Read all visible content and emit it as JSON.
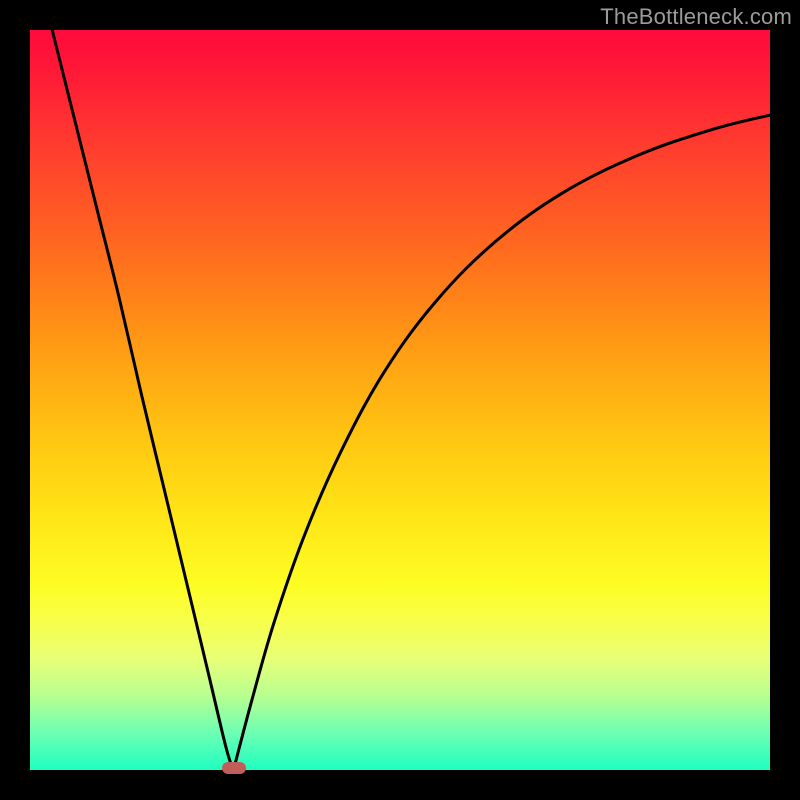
{
  "watermark": "TheBottleneck.com",
  "colors": {
    "frame_bg": "#000000",
    "watermark": "#9b9b9b",
    "curve": "#000000",
    "pill": "#c15e59",
    "gradient_stops": [
      "#ff0a3c",
      "#ff1737",
      "#ff3a2f",
      "#ff5a24",
      "#ff7e19",
      "#ffa313",
      "#ffc512",
      "#ffe316",
      "#fdfd23",
      "#f8ff4b",
      "#e8ff77",
      "#b7ff91",
      "#6dffb3",
      "#1effc0"
    ]
  },
  "chart_data": {
    "type": "line",
    "title": "",
    "xlabel": "",
    "ylabel": "",
    "xlim": [
      0,
      1
    ],
    "ylim": [
      0,
      1
    ],
    "grid": false,
    "legend": false,
    "annotations": [
      {
        "kind": "marker",
        "shape": "pill",
        "x": 0.275,
        "y": 0.0,
        "color": "#c15e59"
      }
    ],
    "series": [
      {
        "name": "left-branch",
        "x": [
          0.03,
          0.06,
          0.09,
          0.12,
          0.15,
          0.18,
          0.21,
          0.24,
          0.265,
          0.275
        ],
        "y": [
          1.0,
          0.88,
          0.76,
          0.64,
          0.51,
          0.385,
          0.26,
          0.135,
          0.03,
          0.0
        ]
      },
      {
        "name": "right-branch",
        "x": [
          0.275,
          0.3,
          0.33,
          0.37,
          0.42,
          0.48,
          0.55,
          0.63,
          0.72,
          0.82,
          0.92,
          1.0
        ],
        "y": [
          0.0,
          0.095,
          0.2,
          0.315,
          0.43,
          0.54,
          0.635,
          0.715,
          0.78,
          0.83,
          0.865,
          0.885
        ]
      }
    ]
  }
}
